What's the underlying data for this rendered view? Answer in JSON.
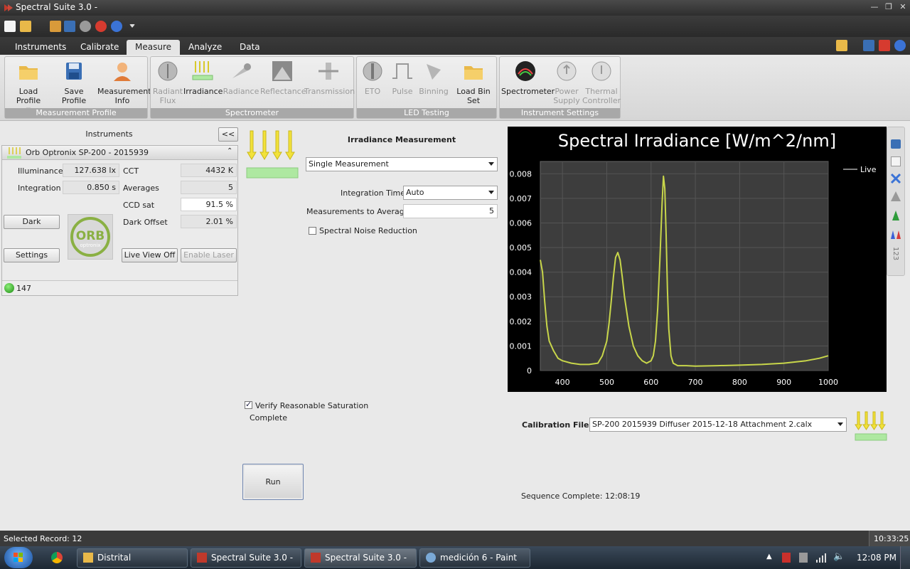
{
  "window": {
    "title": "Spectral Suite 3.0 -"
  },
  "tabs": [
    "Instruments",
    "Calibrate",
    "Measure",
    "Analyze",
    "Data"
  ],
  "active_tab": "Measure",
  "ribbon": {
    "groups": [
      {
        "label": "Measurement Profile",
        "buttons": [
          {
            "line1": "Load Profile",
            "line2": ""
          },
          {
            "line1": "Save Profile",
            "line2": ""
          },
          {
            "line1": "Measurement",
            "line2": "Info"
          }
        ]
      },
      {
        "label": "Spectrometer",
        "buttons": [
          {
            "line1": "Radiant",
            "line2": "Flux"
          },
          {
            "line1": "Irradiance",
            "line2": ""
          },
          {
            "line1": "Radiance",
            "line2": ""
          },
          {
            "line1": "Reflectance",
            "line2": ""
          },
          {
            "line1": "Transmission",
            "line2": ""
          }
        ]
      },
      {
        "label": "LED Testing",
        "buttons": [
          {
            "line1": "ETO",
            "line2": ""
          },
          {
            "line1": "Pulse",
            "line2": ""
          },
          {
            "line1": "Binning",
            "line2": ""
          },
          {
            "line1": "Load Bin Set",
            "line2": ""
          }
        ]
      },
      {
        "label": "Instrument Settings",
        "buttons": [
          {
            "line1": "Spectrometer",
            "line2": ""
          },
          {
            "line1": "Power",
            "line2": "Supply"
          },
          {
            "line1": "Thermal",
            "line2": "Controller"
          }
        ]
      }
    ]
  },
  "instruments": {
    "header": "Instruments",
    "collapse_label": "<<",
    "device": "Orb Optronix SP-200 - 2015939",
    "fields": {
      "illuminance_label": "Illuminance",
      "illuminance": "127.638 lx",
      "integration_label": "Integration",
      "integration": "0.850 s",
      "cct_label": "CCT",
      "cct": "4432 K",
      "averages_label": "Averages",
      "averages": "5",
      "ccd_label": "CCD sat",
      "ccd": "91.5 %",
      "dark_offset_label": "Dark Offset",
      "dark_offset": "2.01 %"
    },
    "buttons": {
      "dark": "Dark",
      "settings": "Settings",
      "live_view": "Live View Off",
      "laser": "Enable Laser"
    },
    "logo_text": "ORB",
    "logo_sub": "optronix",
    "status_count": "147"
  },
  "measurement": {
    "title": "Irradiance Measurement",
    "mode": "Single Measurement",
    "integration_time_label": "Integration Time",
    "integration_time": "Auto",
    "averages_label": "Measurements to Average",
    "averages": "5",
    "noise_label": "Spectral Noise Reduction",
    "noise_checked": false,
    "verify_label": "Verify Reasonable Saturation",
    "verify_checked": true,
    "complete_label": "Complete",
    "run_label": "Run"
  },
  "chart_data": {
    "type": "line",
    "title": "Spectral Irradiance [W/m^2/nm]",
    "xlabel": "",
    "ylabel": "",
    "xlim": [
      350,
      1000
    ],
    "ylim": [
      0,
      0.0085
    ],
    "x_ticks": [
      "400",
      "500",
      "600",
      "700",
      "800",
      "900",
      "1000"
    ],
    "y_ticks": [
      "0",
      "0.001",
      "0.002",
      "0.003",
      "0.004",
      "0.005",
      "0.006",
      "0.007",
      "0.008"
    ],
    "legend": "top-right",
    "series": [
      {
        "name": "Live",
        "color": "#c8d64a",
        "x": [
          350,
          355,
          360,
          365,
          370,
          380,
          390,
          400,
          420,
          440,
          460,
          480,
          490,
          500,
          505,
          510,
          515,
          520,
          525,
          530,
          535,
          540,
          550,
          560,
          570,
          580,
          590,
          600,
          605,
          610,
          615,
          620,
          625,
          628,
          631,
          634,
          637,
          640,
          645,
          650,
          660,
          680,
          700,
          750,
          800,
          850,
          900,
          950,
          980,
          1000
        ],
        "y": [
          0.0045,
          0.004,
          0.0028,
          0.0018,
          0.0012,
          0.0008,
          0.0005,
          0.0004,
          0.0003,
          0.00025,
          0.00025,
          0.0003,
          0.0006,
          0.0012,
          0.0019,
          0.0028,
          0.0038,
          0.0046,
          0.0048,
          0.0045,
          0.0038,
          0.003,
          0.0018,
          0.001,
          0.0006,
          0.0004,
          0.0003,
          0.0004,
          0.0006,
          0.0012,
          0.0025,
          0.0045,
          0.0068,
          0.0079,
          0.0074,
          0.0055,
          0.0033,
          0.0017,
          0.0006,
          0.0003,
          0.0002,
          0.0002,
          0.00018,
          0.0002,
          0.00022,
          0.00025,
          0.0003,
          0.0004,
          0.0005,
          0.0006
        ]
      }
    ]
  },
  "calibration": {
    "label": "Calibration File:",
    "file": "SP-200 2015939 Diffuser 2015-12-18 Attachment 2.calx"
  },
  "sequence_status": "Sequence Complete: 12:08:19",
  "statusbar": {
    "left": "Selected Record: 12",
    "right": "10:33:25"
  },
  "taskbar": {
    "items": [
      "Distrital",
      "Spectral Suite 3.0 -",
      "Spectral Suite 3.0 -",
      "medición 6 - Paint"
    ],
    "clock": "12:08 PM"
  }
}
